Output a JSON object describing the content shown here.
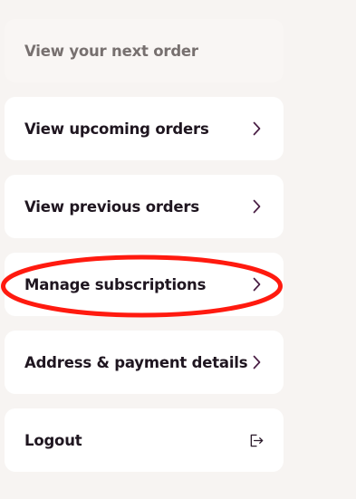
{
  "menu": {
    "items": [
      {
        "label": "View your next order",
        "icon": "none",
        "enabled": false
      },
      {
        "label": "View upcoming orders",
        "icon": "chevron-right-icon",
        "enabled": true
      },
      {
        "label": "View previous orders",
        "icon": "chevron-right-icon",
        "enabled": true
      },
      {
        "label": "Manage subscriptions",
        "icon": "chevron-right-icon",
        "enabled": true,
        "highlighted": true
      },
      {
        "label": "Address & payment details",
        "icon": "chevron-right-icon",
        "enabled": true
      },
      {
        "label": "Logout",
        "icon": "logout-icon",
        "enabled": true
      }
    ]
  },
  "colors": {
    "page_background": "#f7f4f2",
    "card_background": "#ffffff",
    "text": "#1f1620",
    "muted_text": "#77706f",
    "icon": "#4a1f45",
    "highlight_annotation": "#ff1a0f"
  }
}
